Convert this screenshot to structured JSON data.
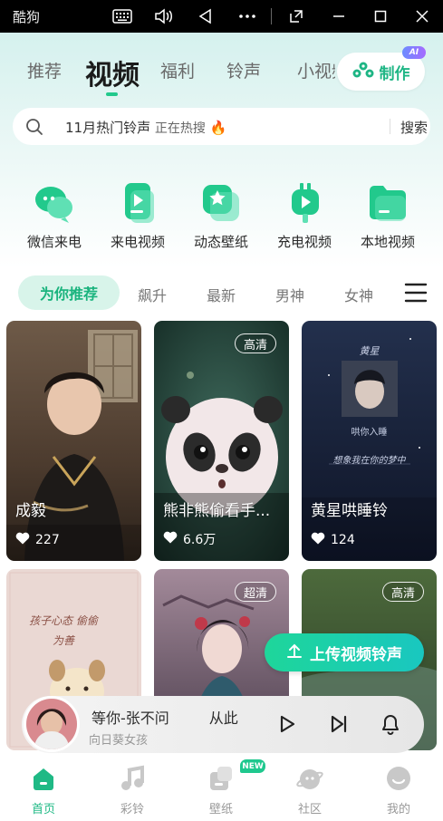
{
  "titlebar": {
    "app_name": "酷狗"
  },
  "top_tabs": [
    {
      "label": "推荐"
    },
    {
      "label": "视频"
    },
    {
      "label": "福利"
    },
    {
      "label": "铃声"
    },
    {
      "label": "小视频"
    }
  ],
  "make_button": {
    "label": "制作",
    "badge": "AI"
  },
  "search": {
    "query": "11月热门铃声",
    "hot_text": "正在热搜",
    "fire_icon": "🔥",
    "button": "搜索"
  },
  "quick_entries": [
    {
      "label": "微信来电",
      "icon": "wechat-call-icon"
    },
    {
      "label": "来电视频",
      "icon": "call-video-icon"
    },
    {
      "label": "动态壁纸",
      "icon": "live-wallpaper-icon"
    },
    {
      "label": "充电视频",
      "icon": "charging-video-icon"
    },
    {
      "label": "本地视频",
      "icon": "local-video-icon"
    }
  ],
  "categories": [
    {
      "label": "为你推荐"
    },
    {
      "label": "飙升"
    },
    {
      "label": "最新"
    },
    {
      "label": "男神"
    },
    {
      "label": "女神"
    }
  ],
  "cards": [
    {
      "title": "成毅",
      "likes": "227",
      "tag": ""
    },
    {
      "title": "熊非熊偷看手...",
      "likes": "6.6万",
      "tag": "高清"
    },
    {
      "title": "黄星哄睡铃",
      "likes": "124",
      "tag": "",
      "poster_name": "黄星",
      "poster_line1": "哄你入睡",
      "poster_line2": "想象我在你的梦中"
    },
    {
      "title": "",
      "likes": "",
      "tag": "",
      "poster_text": "孩子心态 偷偷为善"
    },
    {
      "title": "",
      "likes": "",
      "tag": "超清"
    },
    {
      "title": "",
      "likes": "",
      "tag": "高清"
    }
  ],
  "upload_button": {
    "label": "上传视频铃声"
  },
  "player": {
    "song": "等你-张不问",
    "song_more": "从此",
    "artist": "向日葵女孩"
  },
  "bottom_nav": [
    {
      "label": "首页",
      "active": true
    },
    {
      "label": "彩铃",
      "active": false
    },
    {
      "label": "壁纸",
      "active": false,
      "badge": "NEW"
    },
    {
      "label": "社区",
      "active": false
    },
    {
      "label": "我的",
      "active": false
    }
  ],
  "colors": {
    "accent": "#1fb985",
    "accent_light": "#d8f4ea"
  }
}
